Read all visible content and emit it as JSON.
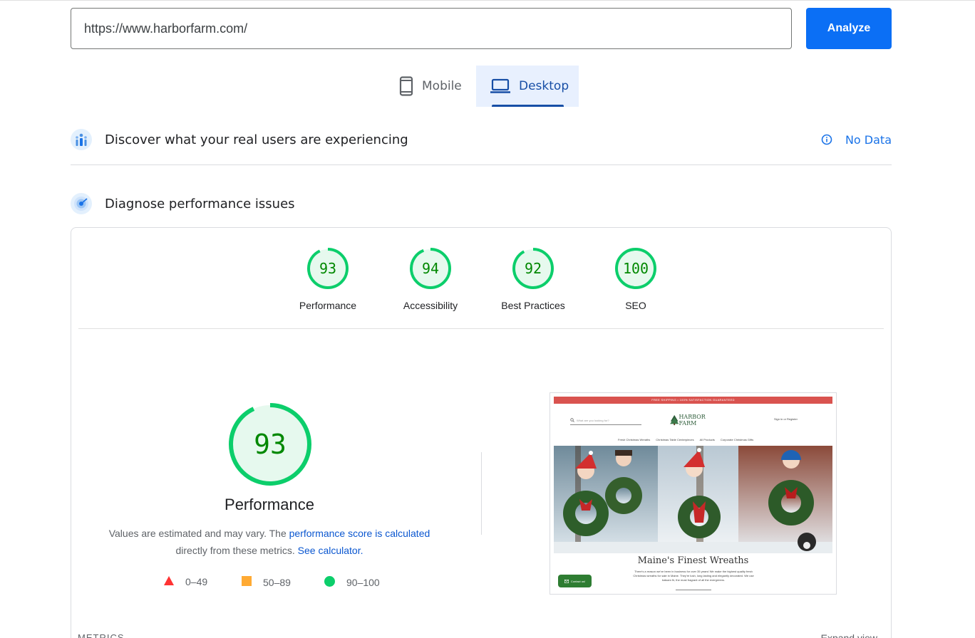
{
  "search": {
    "url_value": "https://www.harborfarm.com/",
    "analyze_label": "Analyze"
  },
  "device_tabs": [
    {
      "label": "Mobile",
      "icon": "smartphone-icon",
      "selected": false
    },
    {
      "label": "Desktop",
      "icon": "laptop-icon",
      "selected": true
    }
  ],
  "field_data": {
    "title": "Discover what your real users are experiencing",
    "status_label": "No Data",
    "icon": "users-chart-icon"
  },
  "lab_data": {
    "title": "Diagnose performance issues",
    "icon": "radar-icon"
  },
  "scores": [
    {
      "label": "Performance",
      "value": "93",
      "fraction": 0.93
    },
    {
      "label": "Accessibility",
      "value": "94",
      "fraction": 0.94
    },
    {
      "label": "Best Practices",
      "value": "92",
      "fraction": 0.92
    },
    {
      "label": "SEO",
      "value": "100",
      "fraction": 1.0
    }
  ],
  "main_score": {
    "value": "93",
    "fraction": 0.93,
    "label": "Performance",
    "desc_prefix": "Values are estimated and may vary. The ",
    "desc_link1": "performance score is calculated",
    "desc_mid": "directly from these metrics. ",
    "desc_link2": "See calculator."
  },
  "legend": [
    {
      "range": "0–49",
      "shape": "triangle",
      "color": "#ff3333"
    },
    {
      "range": "50–89",
      "shape": "square",
      "color": "#ffaa33"
    },
    {
      "range": "90–100",
      "shape": "circle",
      "color": "#0cce6b"
    }
  ],
  "colors": {
    "pass_green": "#0cce6b",
    "pass_text": "#008800",
    "pass_fill": "#e6f9ee",
    "accent_blue": "#0b6ff5",
    "tab_blue": "#174ea6"
  },
  "screenshot": {
    "banner": "FREE SHIPPING • 100% SATISFACTION GUARANTEED",
    "search_placeholder": "What are you looking for?",
    "logo": "HARBOR FARM",
    "account": "Sign in or Register",
    "nav": [
      "Fresh Christmas Wreaths",
      "Christmas Table Centerpieces",
      "All Products",
      "Corporate Christmas Gifts"
    ],
    "headline": "Maine's Finest Wreaths",
    "body": "There's a reason we've been in business for over 35 years! We make the highest quality fresh Christmas wreaths for sale in Maine. They're lush, long lasting and elegantly decorated. We use balsam fir, the most fragrant of all the evergreens.",
    "contact": "Contact us!"
  },
  "metrics_label": "METRICS",
  "expand_label": "Expand view"
}
